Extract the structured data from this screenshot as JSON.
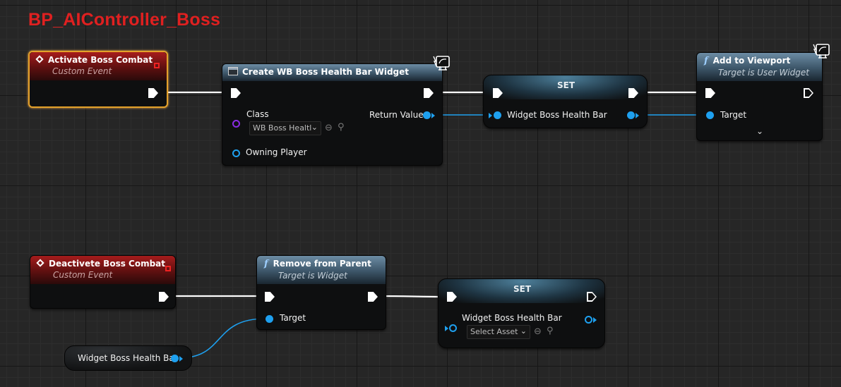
{
  "graph": {
    "title": "BP_AIController_Boss"
  },
  "nodes": {
    "activate": {
      "title": "Activate Boss Combat",
      "subtitle": "Custom Event",
      "icon": "event-diamond-icon"
    },
    "create_widget": {
      "title": "Create WB Boss Health Bar Widget",
      "icon": "class-widget-icon",
      "class_label": "Class",
      "class_value": "WB Boss Healtl",
      "owning_player_label": "Owning Player",
      "return_label": "Return Value"
    },
    "set_top": {
      "title": "SET",
      "var_label": "Widget Boss Health Bar"
    },
    "add_viewport": {
      "title": "Add to Viewport",
      "subtitle": "Target is User Widget",
      "target_label": "Target"
    },
    "deactivate": {
      "title": "Deactivete Boss Combat",
      "subtitle": "Custom Event"
    },
    "remove_parent": {
      "title": "Remove from Parent",
      "subtitle": "Target is Widget",
      "target_label": "Target"
    },
    "set_bottom": {
      "title": "SET",
      "var_label": "Widget Boss Health Bar",
      "asset_value": "Select Asset"
    },
    "getter": {
      "label": "Widget Boss Health Bar"
    }
  },
  "colors": {
    "exec_wire": "#ffffff",
    "object_wire": "#1ea0ef",
    "selection": "#e3a12a",
    "event_header": "#a61c1c",
    "function_header": "#6c8ca4",
    "graph_title": "#e02020"
  }
}
